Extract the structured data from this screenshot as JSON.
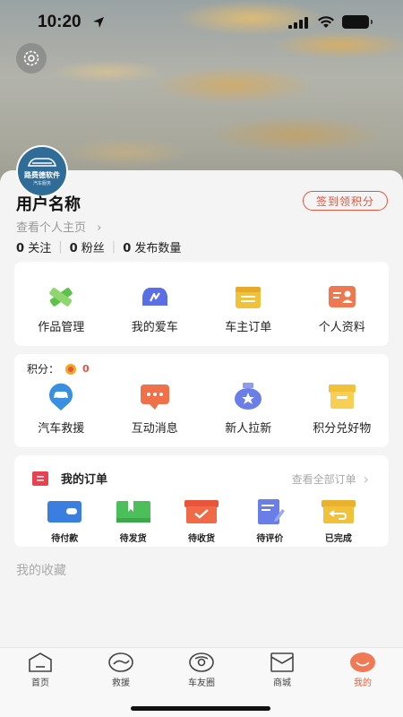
{
  "status_bar": {
    "time": "10:20"
  },
  "profile": {
    "avatar_brand": "路费德软件",
    "avatar_sub": "汽车服务",
    "username": "用户名称",
    "checkin_label": "签到领积分",
    "homepage_link": "查看个人主页",
    "stats": [
      {
        "count": "0",
        "label": "关注"
      },
      {
        "count": "0",
        "label": "粉丝"
      },
      {
        "count": "0",
        "label": "发布数量"
      }
    ]
  },
  "quick_menu": [
    {
      "label": "作品管理",
      "icon": "pencil-icon",
      "color": "#5cc24a"
    },
    {
      "label": "我的爱车",
      "icon": "car-icon",
      "color": "#5a6ee6"
    },
    {
      "label": "车主订单",
      "icon": "notepad-icon",
      "color": "#f2c13a"
    },
    {
      "label": "个人资料",
      "icon": "profile-card-icon",
      "color": "#f07850"
    }
  ],
  "services": {
    "points_label": "积分：",
    "points_value": "0",
    "items": [
      {
        "label": "汽车救援",
        "icon": "rescue-car-icon",
        "color": "#3a8fdf"
      },
      {
        "label": "互动消息",
        "icon": "message-icon",
        "color": "#f0704a"
      },
      {
        "label": "新人拉新",
        "icon": "badge-icon",
        "color": "#6b7ee8"
      },
      {
        "label": "积分兑好物",
        "icon": "shop-icon",
        "color": "#f2c13a"
      }
    ]
  },
  "orders": {
    "title": "我的订单",
    "view_all": "查看全部订单",
    "items": [
      {
        "label": "待付款",
        "icon": "wallet-icon",
        "color": "#3a7ee0"
      },
      {
        "label": "待发货",
        "icon": "package-icon",
        "color": "#4cbf5a"
      },
      {
        "label": "待收货",
        "icon": "receive-box-icon",
        "color": "#f06a48"
      },
      {
        "label": "待评价",
        "icon": "review-icon",
        "color": "#6a7ee8"
      },
      {
        "label": "已完成",
        "icon": "return-box-icon",
        "color": "#f2c13a"
      }
    ]
  },
  "favorites_title": "我的收藏",
  "tabs": [
    {
      "label": "首页",
      "icon": "home-icon",
      "active": false
    },
    {
      "label": "救援",
      "icon": "rescue-icon",
      "active": false
    },
    {
      "label": "车友圈",
      "icon": "community-icon",
      "active": false
    },
    {
      "label": "商城",
      "icon": "mall-icon",
      "active": false
    },
    {
      "label": "我的",
      "icon": "me-icon",
      "active": true
    }
  ],
  "colors": {
    "accent": "#e0563e",
    "tab_active": "#e9613f"
  }
}
